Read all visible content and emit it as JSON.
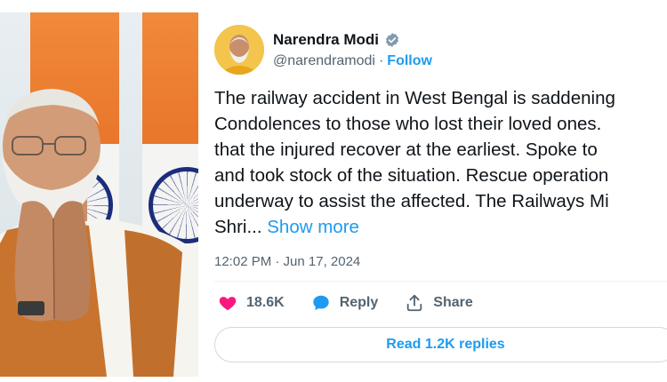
{
  "image": {
    "subject": "photo-of-person-with-folded-hands"
  },
  "tweet": {
    "author_name": "Narendra Modi",
    "handle": "@narendramodi",
    "separator": "·",
    "follow_label": "Follow",
    "text": "The railway accident in West Bengal is saddening\nCondolences to those who lost their loved ones.\nthat the injured recover at the earliest. Spoke to\nand took stock of the situation. Rescue operation\nunderway to assist the affected. The Railways Mi\nShri...",
    "show_more_label": "Show more",
    "timestamp": "12:02 PM · Jun 17, 2024",
    "likes": "18.6K",
    "reply_label": "Reply",
    "share_label": "Share",
    "read_replies_label": "Read 1.2K replies"
  },
  "colors": {
    "link": "#1d9bf0",
    "like": "#f91880",
    "muted": "#536471"
  },
  "icons": {
    "verified": "verified-badge-icon",
    "like": "heart-icon",
    "reply": "speech-bubble-icon",
    "share": "share-upload-icon"
  }
}
